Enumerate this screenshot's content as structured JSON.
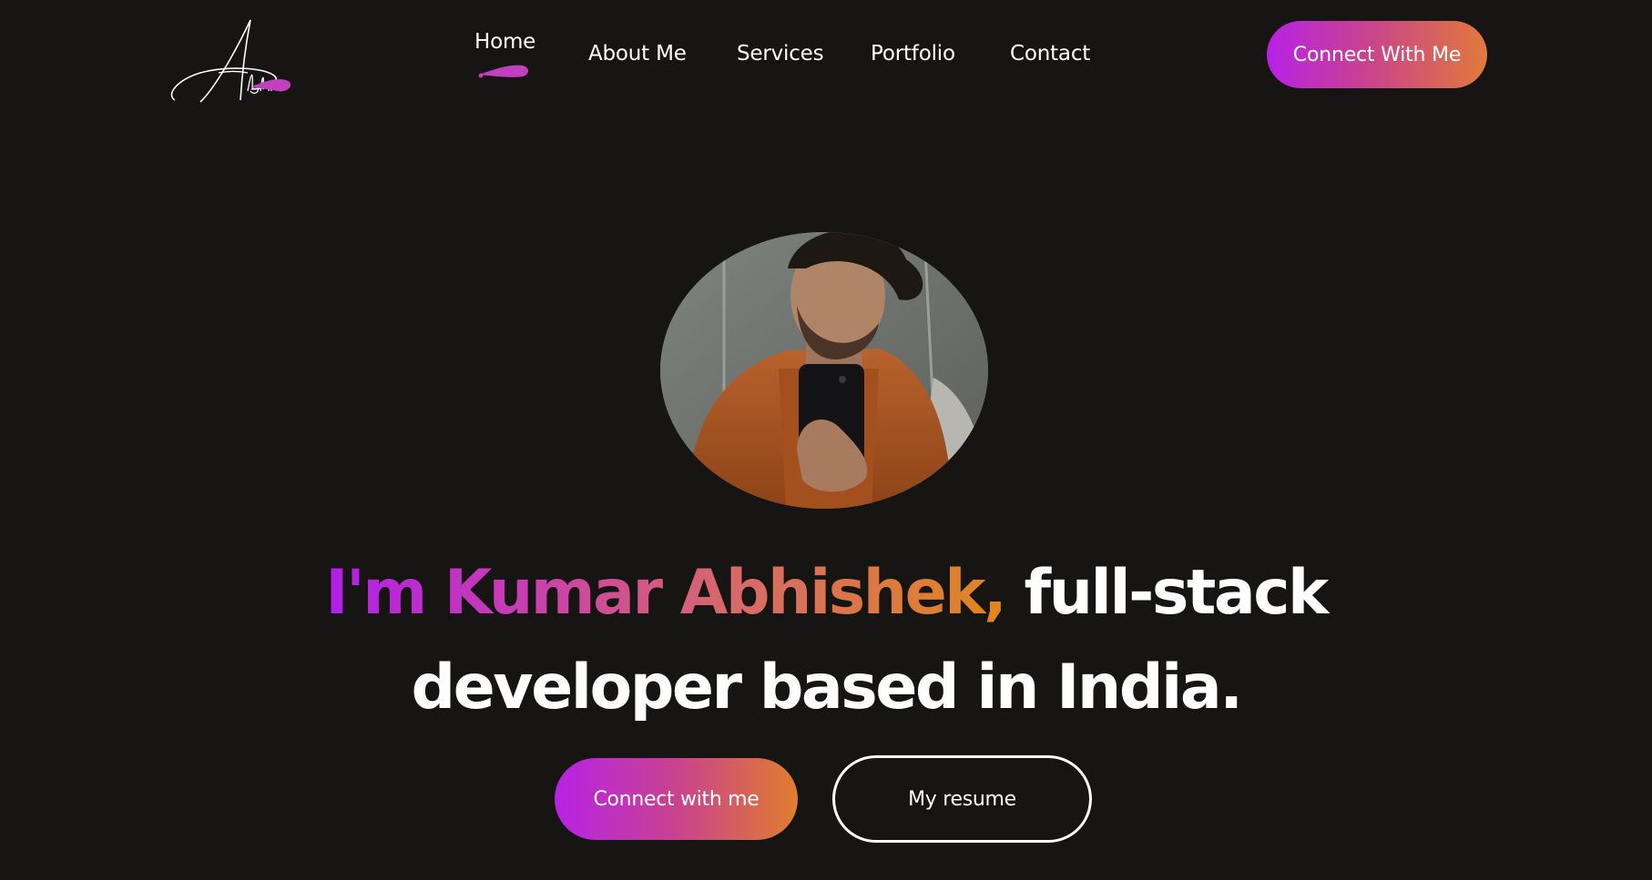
{
  "brand": {
    "logo_text": "Abhi",
    "accent_color": "#c23fbf"
  },
  "nav": {
    "items": [
      {
        "label": "Home",
        "active": true
      },
      {
        "label": "About Me",
        "active": false
      },
      {
        "label": "Services",
        "active": false
      },
      {
        "label": "Portfolio",
        "active": false
      },
      {
        "label": "Contact",
        "active": false
      }
    ],
    "cta_label": "Connect With Me"
  },
  "hero": {
    "avatar_icon": "profile-photo",
    "headline_highlight": "I'm Kumar Abhishek,",
    "headline_rest_line1": " full-stack",
    "headline_line2": "developer based in India.",
    "primary_button": "Connect with me",
    "secondary_button": "My resume"
  },
  "colors": {
    "background": "#161514",
    "gradient_start": "#b622e6",
    "gradient_mid": "#c9428f",
    "gradient_end": "#e07d2e",
    "text": "#ffffff"
  }
}
